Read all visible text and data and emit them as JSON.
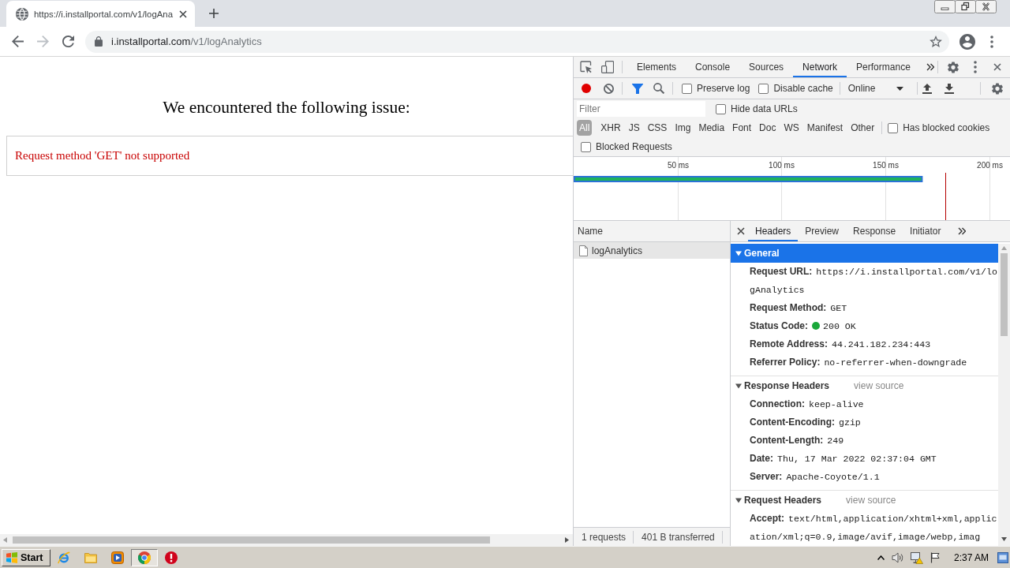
{
  "browser": {
    "tabs": [
      {
        "title": "https://i.installportal.com/v1/logAna",
        "selected": true
      }
    ],
    "nav": [
      {
        "kind": "back",
        "disabled": false
      },
      {
        "kind": "forward",
        "disabled": true
      },
      {
        "kind": "reload",
        "disabled": false
      }
    ],
    "address": {
      "host": "i.installportal.com",
      "path": "/v1/logAnalytics"
    }
  },
  "page": {
    "heading": "We encountered the following issue:",
    "message": "Request method 'GET' not supported"
  },
  "devtools": {
    "panel_tabs": [
      {
        "label": "Elements",
        "selected": false
      },
      {
        "label": "Console",
        "selected": false
      },
      {
        "label": "Sources",
        "selected": false
      },
      {
        "label": "Network",
        "selected": true
      },
      {
        "label": "Performance",
        "selected": false
      }
    ],
    "toolbar": {
      "recording": true,
      "filter_on": true,
      "options": [
        {
          "label": "Preserve log",
          "checked": false
        },
        {
          "label": "Disable cache",
          "checked": false
        }
      ],
      "throttling": "Online"
    },
    "filter": {
      "placeholder": "Filter",
      "options": [
        {
          "label": "Hide data URLs",
          "checked": false
        }
      ]
    },
    "types": [
      {
        "label": "All",
        "selected": true
      },
      {
        "label": "XHR",
        "selected": false
      },
      {
        "label": "JS",
        "selected": false
      },
      {
        "label": "CSS",
        "selected": false
      },
      {
        "label": "Img",
        "selected": false
      },
      {
        "label": "Media",
        "selected": false
      },
      {
        "label": "Font",
        "selected": false
      },
      {
        "label": "Doc",
        "selected": false
      },
      {
        "label": "WS",
        "selected": false
      },
      {
        "label": "Manifest",
        "selected": false
      },
      {
        "label": "Other",
        "selected": false
      }
    ],
    "type_options": [
      {
        "label": "Has blocked cookies",
        "checked": false
      }
    ],
    "blocked_options": [
      {
        "label": "Blocked Requests",
        "checked": false
      }
    ],
    "overview": {
      "chart_data": {
        "type": "bar",
        "orientation": "horizontal",
        "values": [
          168
        ],
        "xlim": [
          0,
          210
        ],
        "xticks": [
          {
            "value": 50,
            "label": "50 ms"
          },
          {
            "value": 100,
            "label": "100 ms"
          },
          {
            "value": 150,
            "label": "150 ms"
          },
          {
            "value": 200,
            "label": "200 ms"
          }
        ],
        "grid": true,
        "ref_lines": [
          {
            "axis": "x",
            "value": 179
          }
        ]
      }
    },
    "requests": {
      "column": "Name",
      "rows": [
        {
          "name": "logAnalytics",
          "selected": true
        }
      ]
    },
    "status_bar": [
      "1 requests",
      "401 B transferred"
    ],
    "detail_tabs": [
      {
        "label": "Headers",
        "selected": true
      },
      {
        "label": "Preview",
        "selected": false
      },
      {
        "label": "Response",
        "selected": false
      },
      {
        "label": "Initiator",
        "selected": false
      }
    ],
    "sections": [
      {
        "title": "General",
        "selected": true,
        "expanded": true,
        "rows": [
          {
            "name": "Request URL:",
            "value": "https://i.installportal.com/v1/logAnalytics"
          },
          {
            "name": "Request Method:",
            "value": "GET"
          },
          {
            "name": "Status Code:",
            "value": "200 OK",
            "color": "#1aa83a"
          },
          {
            "name": "Remote Address:",
            "value": "44.241.182.234:443"
          },
          {
            "name": "Referrer Policy:",
            "value": "no-referrer-when-downgrade"
          }
        ]
      },
      {
        "title": "Response Headers",
        "selected": false,
        "expanded": true,
        "link": "view source",
        "rows": [
          {
            "name": "Connection:",
            "value": "keep-alive"
          },
          {
            "name": "Content-Encoding:",
            "value": "gzip"
          },
          {
            "name": "Content-Length:",
            "value": "249"
          },
          {
            "name": "Date:",
            "value": "Thu, 17 Mar 2022 02:37:04 GMT"
          },
          {
            "name": "Server:",
            "value": "Apache-Coyote/1.1"
          }
        ]
      },
      {
        "title": "Request Headers",
        "selected": false,
        "expanded": true,
        "link": "view source",
        "rows": [
          {
            "name": "Accept:",
            "value": "text/html,application/xhtml+xml,application/xml;q=0.9,image/avif,image/webp,imag"
          }
        ]
      }
    ]
  },
  "taskbar": {
    "start": "Start",
    "apps": [
      {
        "kind": "ie",
        "selected": false
      },
      {
        "kind": "folder",
        "selected": false
      },
      {
        "kind": "media",
        "selected": false
      },
      {
        "kind": "chrome",
        "selected": true
      },
      {
        "kind": "stop",
        "selected": false
      }
    ],
    "clock": "2:37 AM"
  }
}
